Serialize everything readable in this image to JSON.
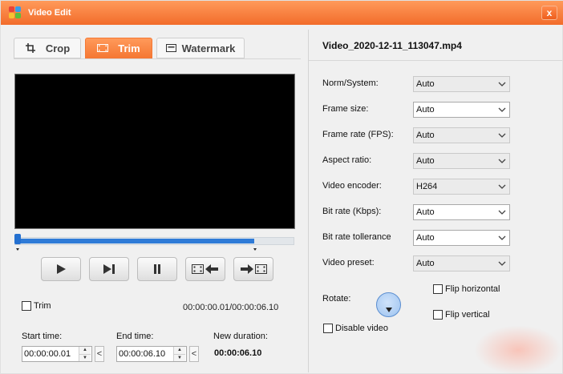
{
  "window": {
    "title": "Video Edit",
    "close_label": "x",
    "accent_color": "#f57834"
  },
  "tabs": [
    {
      "label": "Crop",
      "icon": "crop-icon",
      "active": false
    },
    {
      "label": "Trim",
      "icon": "film-icon",
      "active": true
    },
    {
      "label": "Watermark",
      "icon": "watermark-icon",
      "active": false
    }
  ],
  "player": {
    "progress_fraction": 0.86,
    "controls": [
      "play-icon",
      "next-frame-icon",
      "pause-icon",
      "set-start-icon",
      "set-end-icon"
    ],
    "total_time": "00:00:00.01/00:00:06.10"
  },
  "trim": {
    "trim_label": "Trim",
    "start_label": "Start time:",
    "start_value": "00:00:00.01",
    "end_label": "End time:",
    "end_value": "00:00:06.10",
    "duration_label": "New duration:",
    "duration_value": "00:00:06.10",
    "set_button_label": "<"
  },
  "file": {
    "name": "Video_2020-12-11_113047.mp4"
  },
  "properties": [
    {
      "label": "Norm/System:",
      "value": "Auto",
      "enabled": false
    },
    {
      "label": "Frame size:",
      "value": "Auto",
      "enabled": true
    },
    {
      "label": "Frame rate (FPS):",
      "value": "Auto",
      "enabled": false
    },
    {
      "label": "Aspect ratio:",
      "value": "Auto",
      "enabled": false
    },
    {
      "label": "Video encoder:",
      "value": "H264",
      "enabled": false
    },
    {
      "label": "Bit rate (Kbps):",
      "value": "Auto",
      "enabled": true
    },
    {
      "label": "Bit rate tollerance",
      "value": "Auto",
      "enabled": true
    },
    {
      "label": "Video preset:",
      "value": "Auto",
      "enabled": false
    }
  ],
  "rotate": {
    "label": "Rotate:",
    "flip_horizontal": "Flip horizontal",
    "flip_vertical": "Flip vertical",
    "disable_video": "Disable video"
  }
}
